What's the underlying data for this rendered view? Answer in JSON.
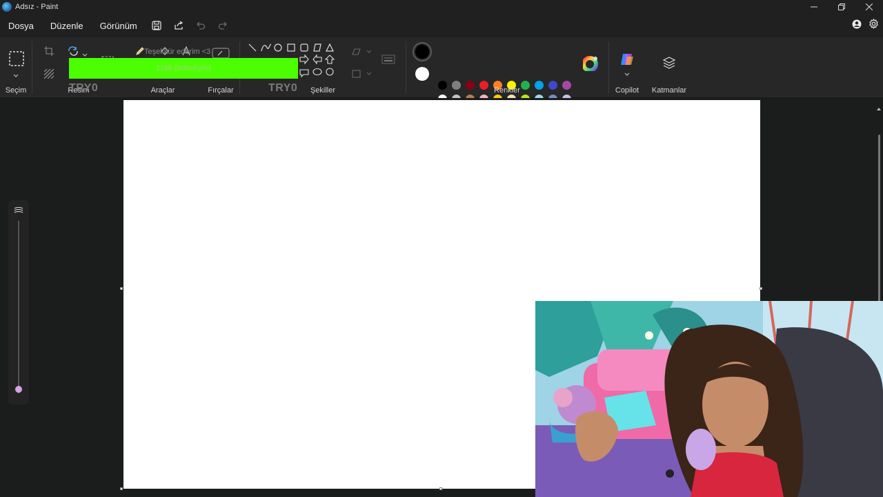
{
  "window": {
    "title": "Adsız - Paint",
    "minimize_icon": "minimize-icon",
    "maximize_icon": "restore-icon",
    "close_icon": "close-icon"
  },
  "menu": {
    "items": [
      "Dosya",
      "Düzenle",
      "Görünüm"
    ],
    "save_icon": "save-icon",
    "share_icon": "share-icon",
    "undo_icon": "undo-icon",
    "redo_icon": "redo-icon",
    "account_icon": "account-icon",
    "settings_icon": "gear-icon"
  },
  "ribbon": {
    "groups": {
      "selection": "Seçim",
      "image": "Resim",
      "tools": "Araçlar",
      "brushes": "Fırçalar",
      "shapes": "Şekiller",
      "colors": "Renkler",
      "copilot": "Copilot",
      "layers": "Katmanlar"
    },
    "palette_row1": [
      "#000000",
      "#7f7f7f",
      "#880015",
      "#ed1c24",
      "#ff7f27",
      "#fff200",
      "#22b14c",
      "#00a2e8",
      "#3f48cc",
      "#a349a4"
    ],
    "palette_row2": [
      "#ffffff",
      "#c3c3c3",
      "#b97a57",
      "#ffaec9",
      "#ffc90e",
      "#efe4b0",
      "#b5e61d",
      "#99d9ea",
      "#7092be",
      "#c8bfe7"
    ],
    "primary_color": "#000000",
    "secondary_color": "#ffffff"
  },
  "overlay": {
    "thanks_text": "Teşekkür ederim <3",
    "progress_text": "1106 (Infinity%)",
    "bar_color": "#4cff00",
    "watermark_left": "TRY0",
    "watermark_right": "TRY0"
  },
  "webcam": {
    "label": "webcam-overlay"
  }
}
